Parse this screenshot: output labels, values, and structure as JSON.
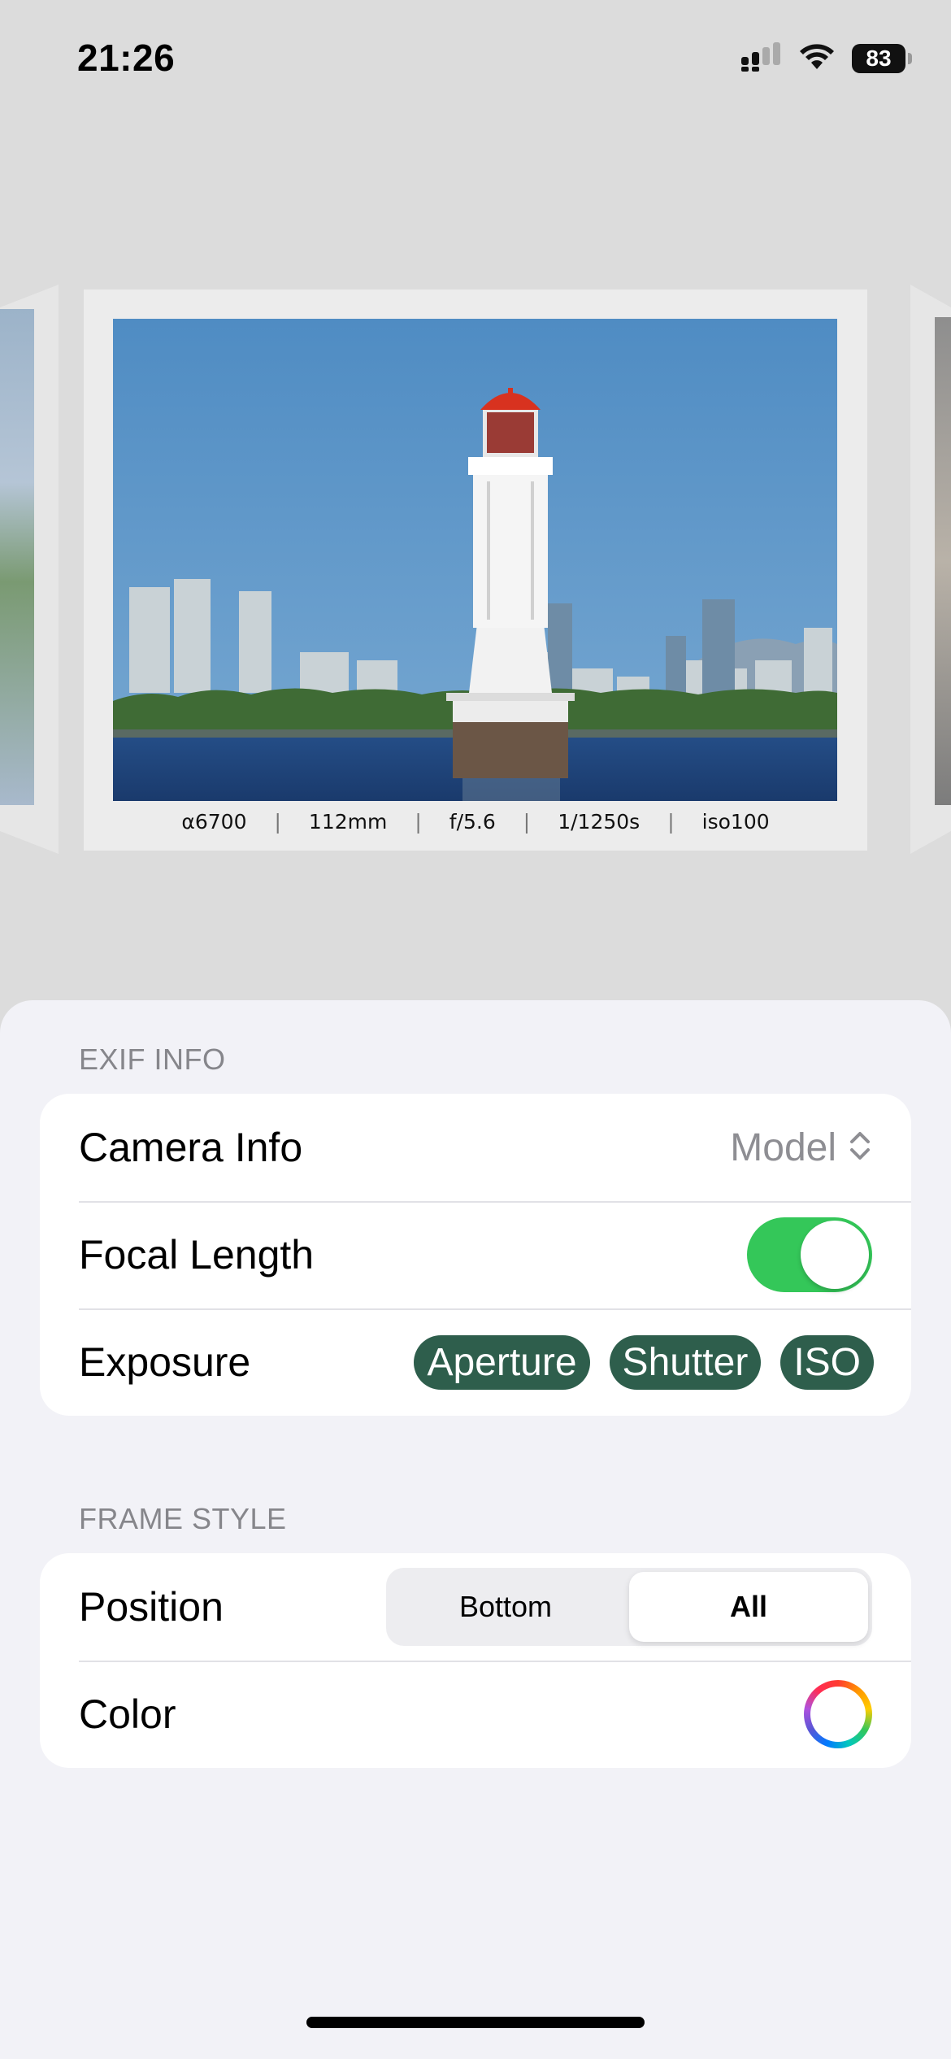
{
  "status_bar": {
    "time": "21:26",
    "battery": "83"
  },
  "preview": {
    "exif_items": [
      "α6700",
      "112mm",
      "f/5.6",
      "1/1250s",
      "iso100"
    ]
  },
  "sections": {
    "exif": {
      "header": "EXIF INFO",
      "camera_info": {
        "label": "Camera Info",
        "value": "Model"
      },
      "focal_length": {
        "label": "Focal Length",
        "enabled": true
      },
      "exposure": {
        "label": "Exposure",
        "chips": [
          "Aperture",
          "Shutter",
          "ISO"
        ]
      }
    },
    "frame_style": {
      "header": "FRAME STYLE",
      "position": {
        "label": "Position",
        "options": [
          "Bottom",
          "All"
        ],
        "selected": "All"
      },
      "color": {
        "label": "Color"
      }
    }
  },
  "colors": {
    "toggle_on": "#34c759",
    "chip_bg": "#2e5e4c",
    "sky": "#5b93c4"
  }
}
